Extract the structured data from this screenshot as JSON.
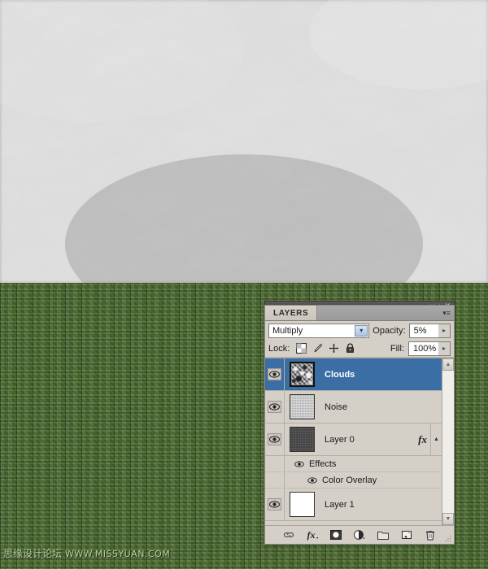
{
  "canvas": {
    "top_region": {
      "name": "clouds-render",
      "base_color": "#9a9a9a"
    },
    "bottom_region": {
      "name": "green-weave-texture",
      "base_color": "#4f7133"
    }
  },
  "watermark": {
    "site_name": "思缘设计论坛",
    "url": "WWW.MISSYUAN.COM"
  },
  "panel": {
    "titlebar": {
      "collapse_icon": "◂◂",
      "separator": "|",
      "close_icon": "✕"
    },
    "tab_label": "LAYERS",
    "menu_icon": "▾≡",
    "blend": {
      "mode": "Multiply",
      "dropdown_arrow": "▾",
      "opacity_label": "Opacity:",
      "opacity_value": "5%",
      "opacity_arrow": "▸"
    },
    "lock": {
      "label": "Lock:",
      "icons": [
        "lock-transparency-icon",
        "lock-image-icon",
        "lock-position-icon",
        "lock-all-icon"
      ],
      "fill_label": "Fill:",
      "fill_value": "100%",
      "fill_arrow": "▸"
    },
    "scrollbar": {
      "up_arrow": "▲",
      "down_arrow": "▼"
    },
    "layers": [
      {
        "name": "Clouds",
        "thumb": "clouds",
        "selected": true,
        "visible": true,
        "has_fx": false,
        "effects": []
      },
      {
        "name": "Noise",
        "thumb": "noise",
        "selected": false,
        "visible": true,
        "has_fx": false,
        "effects": []
      },
      {
        "name": "Layer 0",
        "thumb": "dark",
        "selected": false,
        "visible": true,
        "has_fx": true,
        "fx_label": "fx",
        "expand_arrow": "▲",
        "effects": [
          {
            "name": "Effects",
            "level": 0,
            "visible": true
          },
          {
            "name": "Color Overlay",
            "level": 1,
            "visible": true
          }
        ]
      },
      {
        "name": "Layer 1",
        "thumb": "white",
        "selected": false,
        "visible": true,
        "has_fx": false,
        "effects": []
      }
    ],
    "bottom_toolbar": [
      {
        "icon": "link-layers-icon"
      },
      {
        "icon": "layer-style-fx-icon"
      },
      {
        "icon": "layer-mask-icon"
      },
      {
        "icon": "adjustment-layer-icon"
      },
      {
        "icon": "new-group-icon"
      },
      {
        "icon": "new-layer-icon"
      },
      {
        "icon": "delete-layer-icon"
      }
    ]
  },
  "colors": {
    "panel_bg": "#d4d0c8",
    "selection_blue": "#3a6ea5",
    "titlebar": "#4f4f4f"
  }
}
